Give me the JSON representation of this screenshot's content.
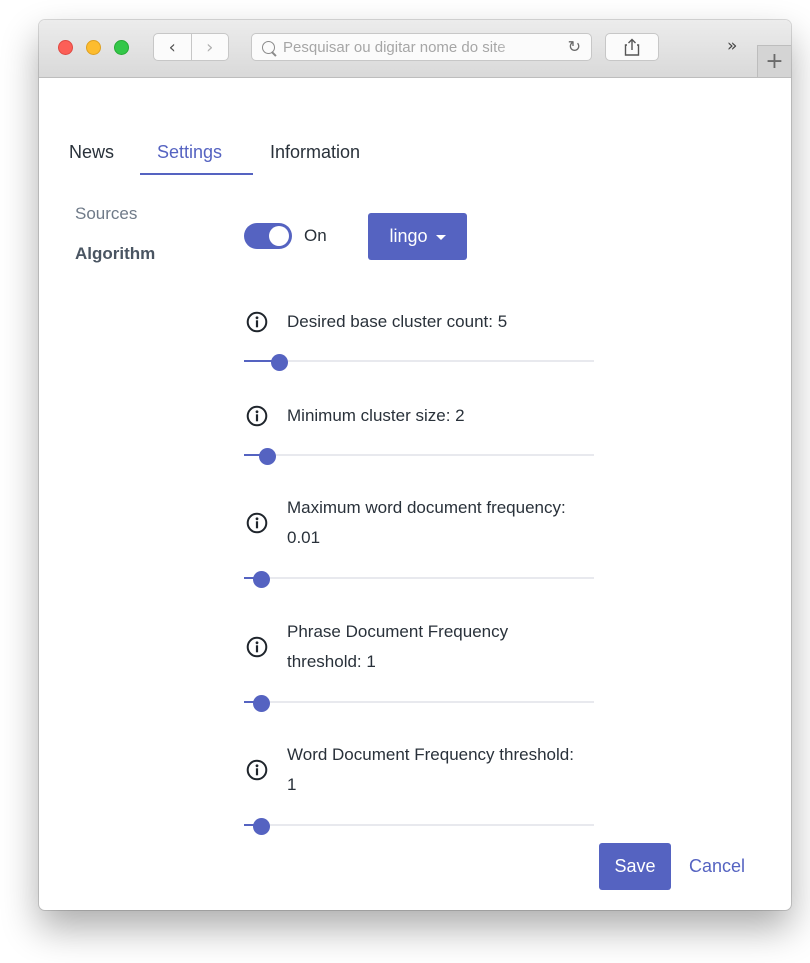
{
  "browser": {
    "back_label": "‹",
    "forward_label": "›",
    "url_placeholder": "Pesquisar ou digitar nome do site",
    "reload_label": "↻",
    "overflow_label": "»",
    "new_tab_label": "+"
  },
  "tabs": [
    {
      "label": "News",
      "active": false
    },
    {
      "label": "Settings",
      "active": true
    },
    {
      "label": "Information",
      "active": false
    }
  ],
  "sidebar": {
    "items": [
      {
        "label": "Sources",
        "active": false
      },
      {
        "label": "Algorithm",
        "active": true
      }
    ]
  },
  "algorithm": {
    "toggle_state": true,
    "toggle_label": "On",
    "dropdown_selected": "lingo"
  },
  "params": [
    {
      "label": "Desired base cluster count: 5",
      "value_fraction": 0.08
    },
    {
      "label": "Minimum cluster size: 2",
      "value_fraction": 0.045
    },
    {
      "label": "Maximum word document frequency: 0.01",
      "value_fraction": 0.025
    },
    {
      "label": "Phrase Document Frequency threshold: 1",
      "value_fraction": 0.025
    },
    {
      "label": "Word Document Frequency threshold: 1",
      "value_fraction": 0.025
    }
  ],
  "actions": {
    "save_label": "Save",
    "cancel_label": "Cancel"
  },
  "colors": {
    "accent": "#5563c1",
    "text": "#29313a",
    "muted": "#6f7a88"
  },
  "icons": {
    "info": "info-circle-icon",
    "share": "share-icon",
    "search": "search-icon",
    "reload": "reload-icon"
  }
}
